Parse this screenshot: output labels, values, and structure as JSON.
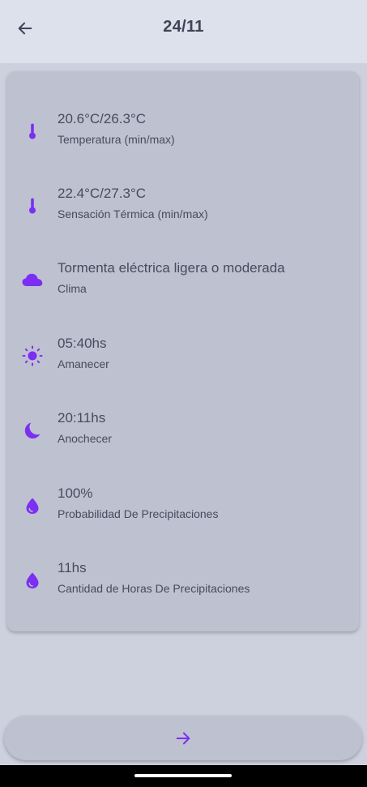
{
  "header": {
    "title": "24/11"
  },
  "colors": {
    "accent": "#7b2ff2",
    "appbar_background": "#dde1eb",
    "page_background": "#cdd1de",
    "card_background": "#bec1cf",
    "text": "#464b5e"
  },
  "details": [
    {
      "icon": "thermometer-icon",
      "value": "20.6°C/26.3°C",
      "label": "Temperatura (min/max)"
    },
    {
      "icon": "thermometer-icon",
      "value": "22.4°C/27.3°C",
      "label": "Sensación Térmica (min/max)"
    },
    {
      "icon": "cloud-icon",
      "value": "Tormenta eléctrica ligera o moderada",
      "label": "Clima"
    },
    {
      "icon": "sun-icon",
      "value": "05:40hs",
      "label": "Amanecer"
    },
    {
      "icon": "moon-icon",
      "value": "20:11hs",
      "label": "Anochecer"
    },
    {
      "icon": "water-drop-icon",
      "value": "100%",
      "label": "Probabilidad De Precipitaciones"
    },
    {
      "icon": "water-drop-icon",
      "value": "11hs",
      "label": "Cantidad de Horas De Precipitaciones"
    }
  ],
  "footer": {
    "next_icon": "arrow-right-icon"
  }
}
